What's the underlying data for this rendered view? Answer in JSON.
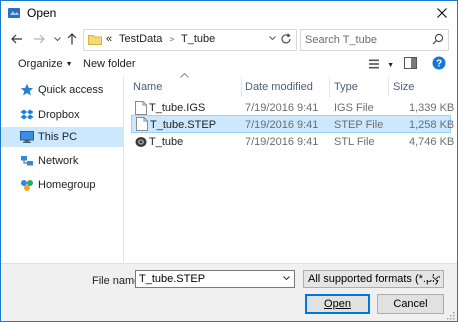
{
  "window": {
    "title": "Open",
    "accent": "#0078d7"
  },
  "nav": {
    "path_prefix": "«",
    "breadcrumbs": [
      "TestData",
      "T_tube"
    ],
    "search_placeholder": "Search T_tube"
  },
  "toolbar": {
    "organize": "Organize",
    "new_folder": "New folder"
  },
  "sidebar": {
    "items": [
      {
        "label": "Quick access",
        "icon": "star-icon"
      },
      {
        "label": "Dropbox",
        "icon": "dropbox-icon"
      },
      {
        "label": "This PC",
        "icon": "computer-icon",
        "active": true
      },
      {
        "label": "Network",
        "icon": "network-icon"
      },
      {
        "label": "Homegroup",
        "icon": "homegroup-icon"
      }
    ]
  },
  "columns": {
    "name": "Name",
    "date": "Date modified",
    "type": "Type",
    "size": "Size"
  },
  "files": [
    {
      "name": "T_tube.IGS",
      "date": "7/19/2016 9:41",
      "type": "IGS File",
      "size": "1,339 KB",
      "icon": "document-icon"
    },
    {
      "name": "T_tube.STEP",
      "date": "7/19/2016 9:41",
      "type": "STEP File",
      "size": "1,258 KB",
      "icon": "document-icon",
      "selected": true
    },
    {
      "name": "T_tube",
      "date": "7/19/2016 9:41",
      "type": "STL File",
      "size": "4,746 KB",
      "icon": "stl-file-icon"
    }
  ],
  "bottom": {
    "file_name_label": "File name:",
    "file_name_value": "T_tube.STEP",
    "file_type_value": "All supported formats (*.ply *.st",
    "open_label": "Open",
    "cancel_label": "Cancel"
  }
}
